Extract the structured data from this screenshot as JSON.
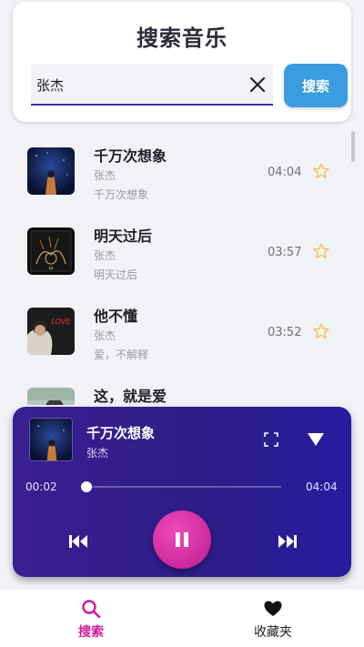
{
  "header": {
    "title": "搜索音乐"
  },
  "search": {
    "value": "张杰",
    "button_label": "搜索"
  },
  "songs": [
    {
      "title": "千万次想象",
      "artist": "张杰",
      "album": "千万次想象",
      "duration": "04:04"
    },
    {
      "title": "明天过后",
      "artist": "张杰",
      "album": "明天过后",
      "duration": "03:57"
    },
    {
      "title": "他不懂",
      "artist": "张杰",
      "album": "爱，不解释",
      "duration": "03:52"
    },
    {
      "title": "这，就是爱",
      "artist": "",
      "album": "",
      "duration": ""
    }
  ],
  "player": {
    "title": "千万次想象",
    "artist": "张杰",
    "current_time": "00:02",
    "total_time": "04:04",
    "progress": 0.008
  },
  "nav": {
    "search_label": "搜索",
    "favorites_label": "收藏夹",
    "active_color": "#d4189e"
  },
  "icons": [
    "clear-icon",
    "star-icon",
    "fullscreen-icon",
    "collapse-icon",
    "previous-icon",
    "pause-icon",
    "next-icon",
    "search-icon",
    "heart-icon"
  ],
  "colors": {
    "accent": "#3a9de0",
    "player_bg": "#2d1d86",
    "play_button": "#d02ea2",
    "star": "#f2c443"
  }
}
